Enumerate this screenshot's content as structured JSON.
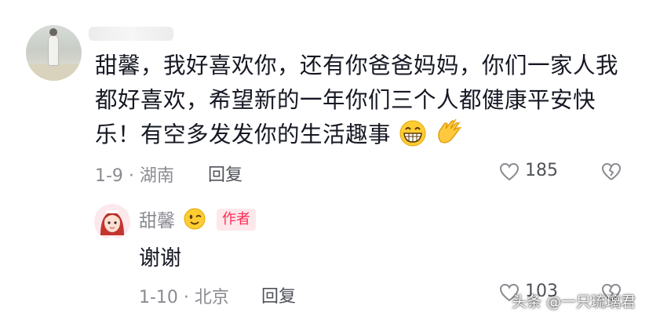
{
  "top_comment": {
    "avatar": "user-photo-avatar",
    "username_blurred": true,
    "text": "甜馨，我好喜欢你，还有你爸爸妈妈，你们一家人我都好喜欢，希望新的一年你们三个人都健康平安快乐！有空多发发你的生活趣事",
    "emojis": [
      "grinning-face-emoji",
      "clapping-hands-emoji"
    ],
    "date_location": "1-9 · 湖南",
    "reply_label": "回复",
    "like_count": "185"
  },
  "reply_comment": {
    "avatar": "cartoon-girl-avatar",
    "username": "甜馨",
    "name_emoji": "winking-face-emoji",
    "author_tag": "作者",
    "text": "谢谢",
    "date_location": "1-10 · 北京",
    "reply_label": "回复",
    "like_count": "103"
  },
  "watermark": "头条 @一只琉璃君",
  "colors": {
    "text": "#161823",
    "meta": "#8a8b91",
    "author_tag_bg": "#fee8ec",
    "author_tag_text": "#fe2c55"
  }
}
